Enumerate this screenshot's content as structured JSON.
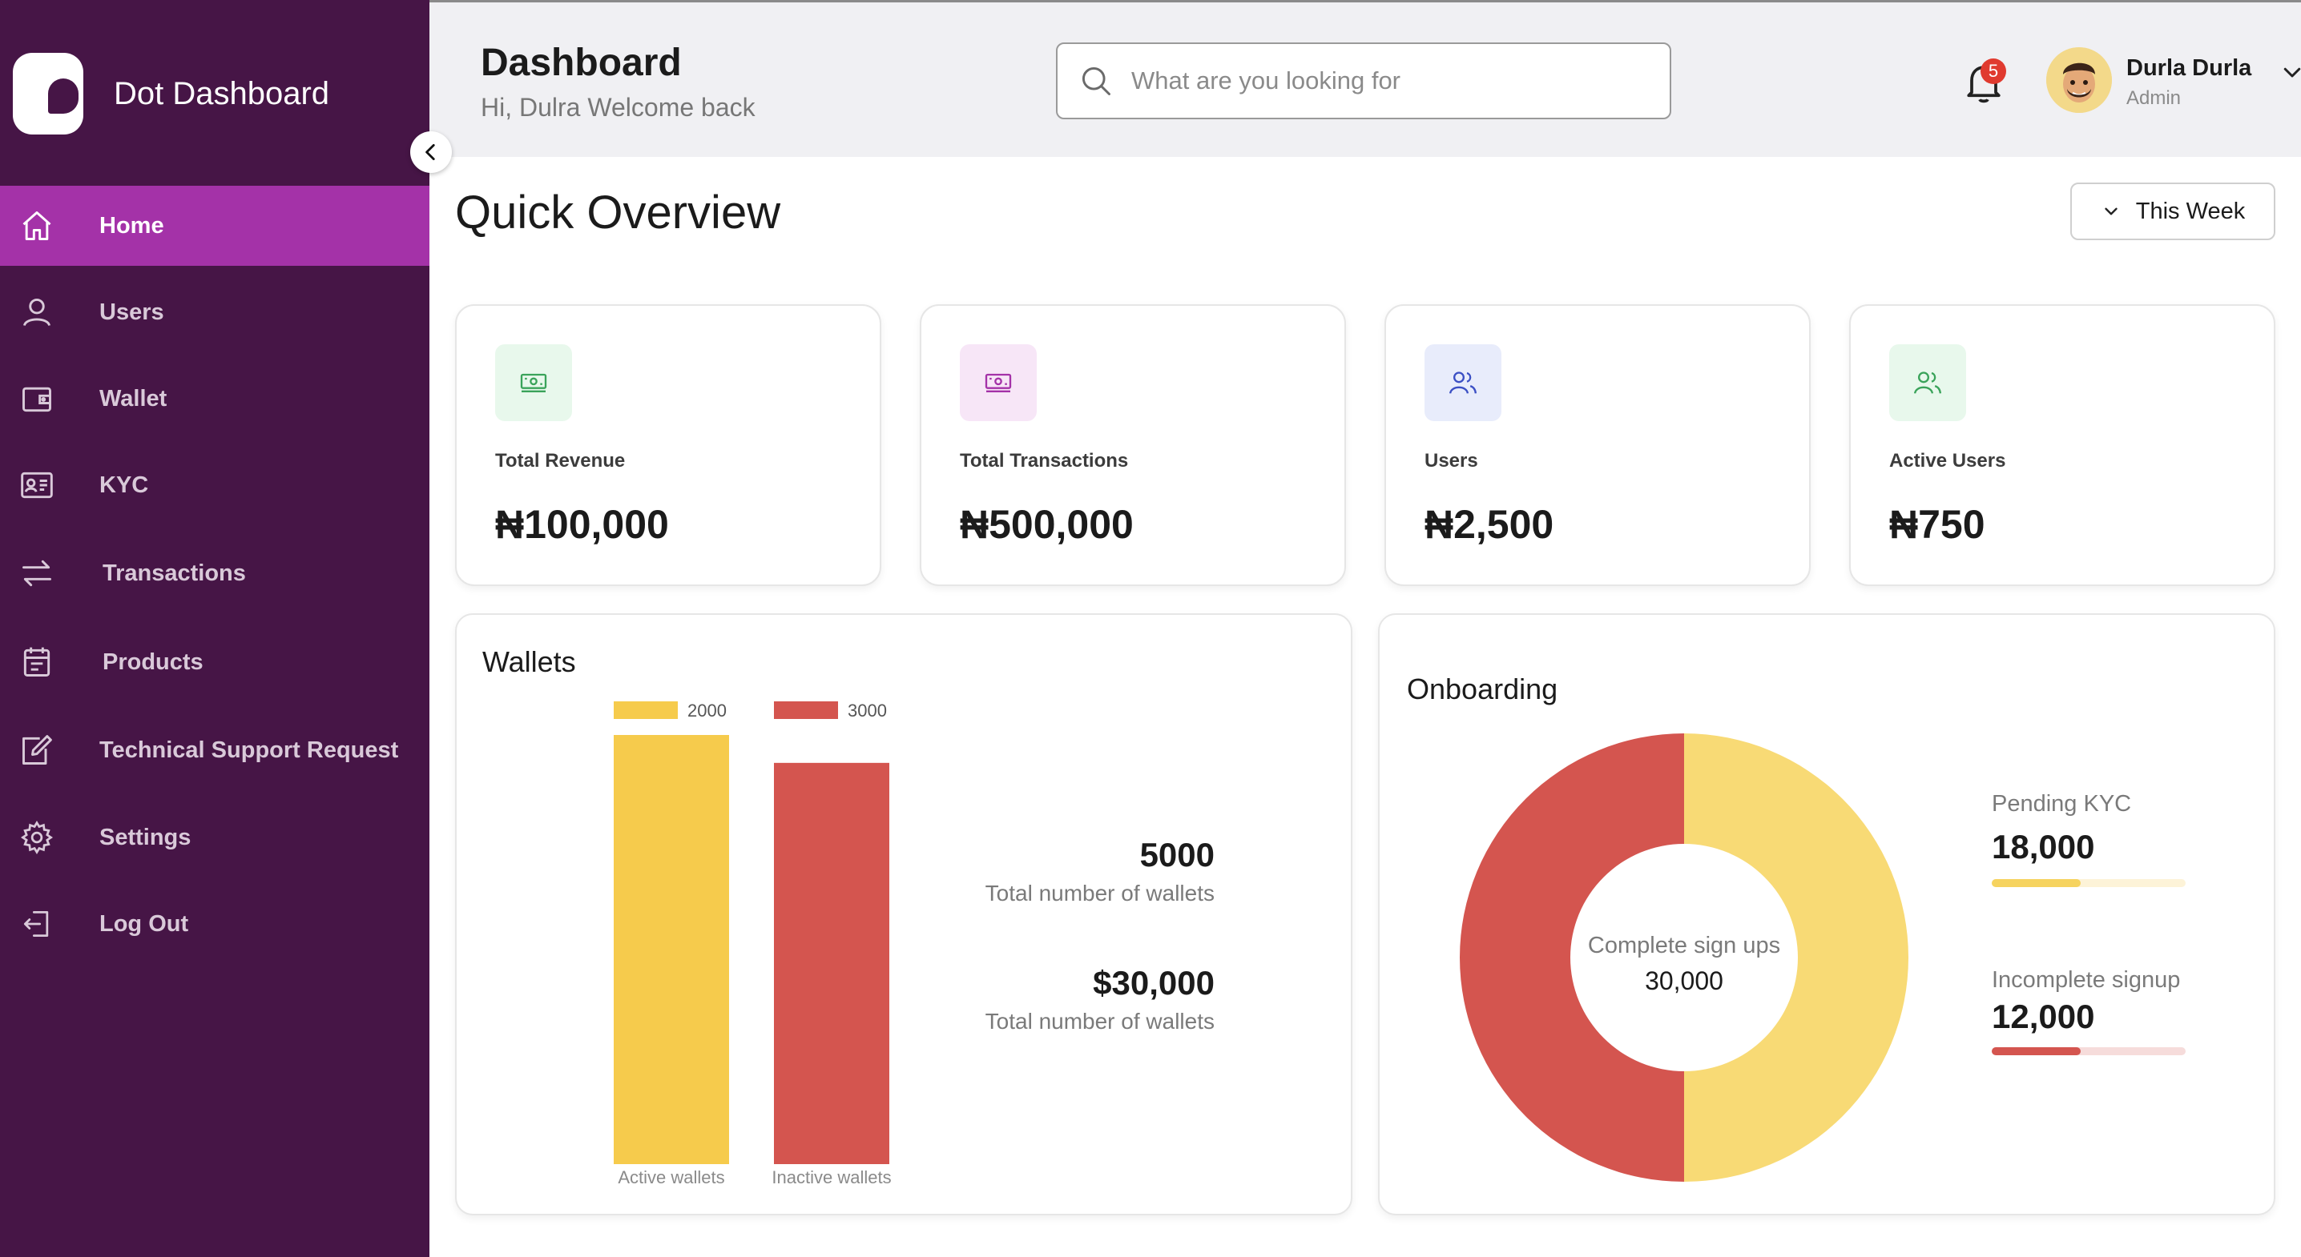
{
  "sidebar": {
    "brand": "Dot Dashboard",
    "items": [
      {
        "label": "Home",
        "icon": "home-icon",
        "active": true
      },
      {
        "label": "Users",
        "icon": "user-icon"
      },
      {
        "label": "Wallet",
        "icon": "wallet-icon"
      },
      {
        "label": "KYC",
        "icon": "id-card-icon"
      },
      {
        "label": "Transactions",
        "icon": "arrows-swap-icon"
      },
      {
        "label": "Products",
        "icon": "calendar-icon"
      },
      {
        "label": "Technical Support Request",
        "icon": "edit-icon"
      },
      {
        "label": "Settings",
        "icon": "gear-icon"
      },
      {
        "label": "Log Out",
        "icon": "logout-icon"
      }
    ]
  },
  "header": {
    "title": "Dashboard",
    "subtitle": "Hi, Dulra Welcome back",
    "search_placeholder": "What are you looking for",
    "notifications": "5",
    "user_name": "Durla Durla",
    "user_role": "Admin"
  },
  "overview": {
    "title": "Quick Overview",
    "period": "This Week",
    "cards": [
      {
        "label": "Total Revenue",
        "value": "₦100,000",
        "icon": "cash-icon",
        "color": "#3aa35a",
        "bg": "#e8f8ec"
      },
      {
        "label": "Total Transactions",
        "value": "₦500,000",
        "icon": "cash-icon",
        "color": "#a432a8",
        "bg": "#f7e6f7"
      },
      {
        "label": "Users",
        "value": "₦2,500",
        "icon": "users-icon",
        "color": "#3b4fc4",
        "bg": "#e8ecfb"
      },
      {
        "label": "Active Users",
        "value": "₦750",
        "icon": "users-icon",
        "color": "#3aa35a",
        "bg": "#e8f8ec"
      }
    ]
  },
  "wallets": {
    "title": "Wallets",
    "count_value": "5000",
    "count_caption": "Total number of wallets",
    "amount_value": "$30,000",
    "amount_caption": "Total number of wallets"
  },
  "onboarding": {
    "title": "Onboarding",
    "center_label": "Complete sign ups",
    "center_value": "30,000",
    "pending_label": "Pending KYC",
    "pending_value": "18,000",
    "pending_progress": 0.46,
    "incomplete_label": "Incomplete signup",
    "incomplete_value": "12,000",
    "incomplete_progress": 0.46
  },
  "colors": {
    "sidebar": "#461546",
    "active": "#a432a8",
    "yellow": "#f6cb4c",
    "red": "#d4554f"
  },
  "chart_data": [
    {
      "type": "bar",
      "categories": [
        "Active wallets",
        "Inactive wallets"
      ],
      "series": [
        {
          "name": "2000",
          "values": [
            2000,
            0
          ]
        },
        {
          "name": "3000",
          "values": [
            0,
            3000
          ]
        }
      ],
      "bar_values": [
        2000,
        1870
      ],
      "ylim": [
        0,
        2000
      ]
    },
    {
      "type": "pie",
      "labels": [
        "Pending KYC",
        "Incomplete signup"
      ],
      "values": [
        18000,
        12000
      ],
      "hole": true
    }
  ]
}
